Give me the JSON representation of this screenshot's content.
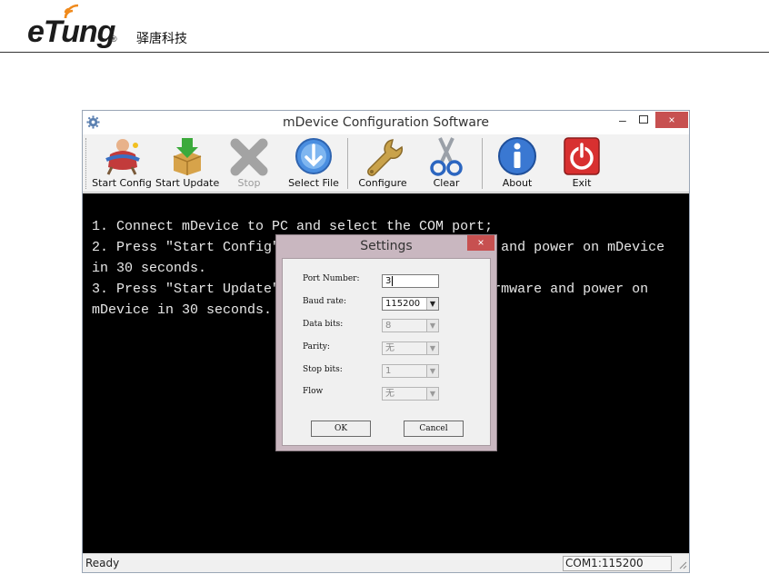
{
  "document": {
    "logo_text": "eTung",
    "logo_mark": "®",
    "company": "驿唐科技"
  },
  "window": {
    "title": "mDevice Configuration Software",
    "controls": {
      "minimize": "–",
      "close": "×"
    }
  },
  "toolbar": {
    "buttons": [
      {
        "label": "Start Config",
        "icon": "person-config-icon"
      },
      {
        "label": "Start Update",
        "icon": "box-download-icon"
      },
      {
        "label": "Stop",
        "icon": "x-stop-icon"
      },
      {
        "label": "Select File",
        "icon": "blue-arrow-icon"
      },
      {
        "label": "Configure",
        "icon": "wrench-icon"
      },
      {
        "label": "Clear",
        "icon": "scissors-icon"
      },
      {
        "label": "About",
        "icon": "info-icon"
      },
      {
        "label": "Exit",
        "icon": "power-icon"
      }
    ]
  },
  "console": {
    "lines": [
      "1. Connect mDevice to PC and select the COM port;",
      "2. Press \"Start Config\"                           and power on mDevice",
      "in 30 seconds.",
      "3. Press \"Start Update\"                          rmware and power on",
      "mDevice in 30 seconds."
    ]
  },
  "status": {
    "text": "Ready",
    "port": "COM1:115200"
  },
  "dialog": {
    "title": "Settings",
    "close": "×",
    "port_label": "Port Number:",
    "port_value": "3",
    "baud_label": "Baud rate:",
    "baud_value": "115200",
    "data_bits_label": "Data bits:",
    "data_bits_value": "8",
    "parity_label": "Parity:",
    "parity_value": "无",
    "stop_bits_label": "Stop bits:",
    "stop_bits_value": "1",
    "flow_label": "Flow",
    "flow_value": "无",
    "ok_label": "OK",
    "cancel_label": "Cancel"
  }
}
